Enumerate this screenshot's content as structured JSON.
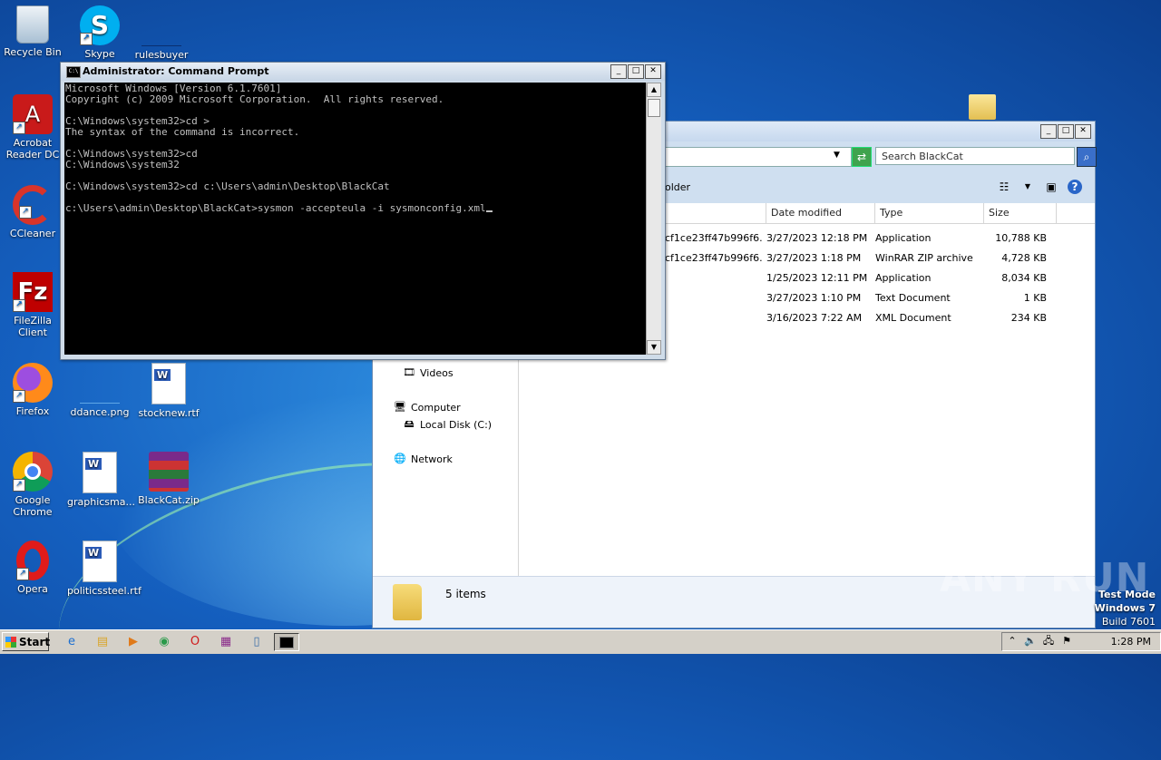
{
  "desktop": {
    "icons": [
      {
        "label": "Recycle Bin",
        "icon": "recycle-bin-icon"
      },
      {
        "label": "Skype",
        "icon": "skype-icon"
      },
      {
        "label": "rulesbuyer",
        "icon": "file-icon"
      },
      {
        "label": "Acrobat Reader DC",
        "icon": "acrobat-icon"
      },
      {
        "label": "CCleaner",
        "icon": "ccleaner-icon"
      },
      {
        "label": "FileZilla Client",
        "icon": "filezilla-icon"
      },
      {
        "label": "Firefox",
        "icon": "firefox-icon"
      },
      {
        "label": "ddance.png",
        "icon": "image-file-icon"
      },
      {
        "label": "stocknew.rtf",
        "icon": "word-doc-icon"
      },
      {
        "label": "Google Chrome",
        "icon": "chrome-icon"
      },
      {
        "label": "graphicsma...",
        "icon": "word-doc-icon"
      },
      {
        "label": "BlackCat.zip",
        "icon": "winrar-icon"
      },
      {
        "label": "Opera",
        "icon": "opera-icon"
      },
      {
        "label": "politicssteel.rtf",
        "icon": "word-doc-icon"
      }
    ]
  },
  "cmd": {
    "title": "Administrator: Command Prompt",
    "icon_text": "C:\\",
    "lines": [
      "Microsoft Windows [Version 6.1.7601]",
      "Copyright (c) 2009 Microsoft Corporation.  All rights reserved.",
      "",
      "C:\\Windows\\system32>cd >",
      "The syntax of the command is incorrect.",
      "",
      "C:\\Windows\\system32>cd",
      "C:\\Windows\\system32",
      "",
      "C:\\Windows\\system32>cd c:\\Users\\admin\\Desktop\\BlackCat",
      "",
      "c:\\Users\\admin\\Desktop\\BlackCat>sysmon -accepteula -i sysmonconfig.xml"
    ]
  },
  "explorer": {
    "search_placeholder": "Search BlackCat",
    "toolbar_text": "older",
    "columns": {
      "name": "",
      "date": "Date modified",
      "type": "Type",
      "size": "Size"
    },
    "files": [
      {
        "name": "cf1ce23ff47b996f6...",
        "date": "3/27/2023 12:18 PM",
        "type": "Application",
        "size": "10,788 KB"
      },
      {
        "name": "cf1ce23ff47b996f6...",
        "date": "3/27/2023 1:18 PM",
        "type": "WinRAR ZIP archive",
        "size": "4,728 KB"
      },
      {
        "name": "",
        "date": "1/25/2023 12:11 PM",
        "type": "Application",
        "size": "8,034 KB"
      },
      {
        "name": "",
        "date": "3/27/2023 1:10 PM",
        "type": "Text Document",
        "size": "1 KB"
      },
      {
        "name": "",
        "date": "3/16/2023 7:22 AM",
        "type": "XML Document",
        "size": "234 KB"
      }
    ],
    "nav": {
      "videos": "Videos",
      "computer": "Computer",
      "local_disk": "Local Disk (C:)",
      "network": "Network"
    },
    "status": "5 items"
  },
  "taskbar": {
    "start_label": "Start",
    "clock": "1:28 PM",
    "quick_launch": [
      "ie-icon",
      "explorer-icon",
      "media-player-icon",
      "chrome-icon",
      "opera-icon",
      "winrar-icon",
      "notepad-icon",
      "cmd-icon"
    ]
  },
  "overlay": {
    "watermark": "ANY RUN",
    "test_mode": "Test Mode",
    "os_name": "Windows 7",
    "build": "Build 7601"
  }
}
